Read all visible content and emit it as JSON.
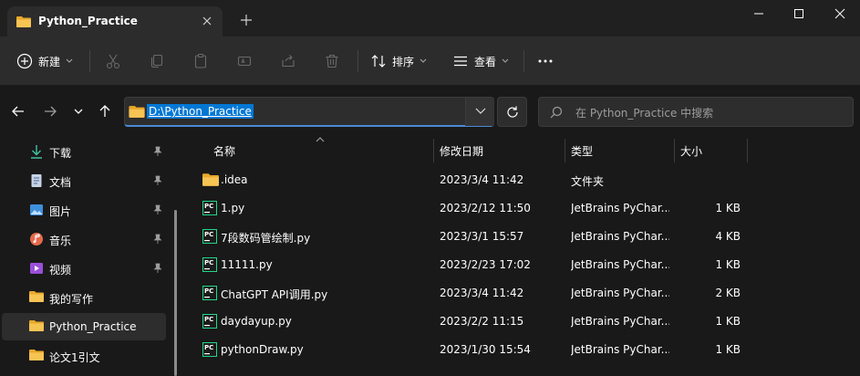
{
  "tab": {
    "title": "Python_Practice"
  },
  "toolbar": {
    "new_label": "新建",
    "sort_label": "排序",
    "view_label": "查看"
  },
  "address": {
    "path": "D:\\Python_Practice",
    "search_placeholder": "在 Python_Practice 中搜索"
  },
  "sidebar": {
    "items": [
      {
        "label": "下载",
        "icon": "download-icon",
        "pinned": true
      },
      {
        "label": "文档",
        "icon": "document-icon",
        "pinned": true
      },
      {
        "label": "图片",
        "icon": "pictures-icon",
        "pinned": true
      },
      {
        "label": "音乐",
        "icon": "music-icon",
        "pinned": true
      },
      {
        "label": "视频",
        "icon": "video-icon",
        "pinned": true
      },
      {
        "label": "我的写作",
        "icon": "folder-icon",
        "pinned": false
      },
      {
        "label": "Python_Practice",
        "icon": "folder-icon",
        "pinned": false,
        "active": true
      },
      {
        "label": "论文1引文",
        "icon": "folder-icon",
        "pinned": false
      }
    ]
  },
  "columns": {
    "name": "名称",
    "date": "修改日期",
    "type": "类型",
    "size": "大小"
  },
  "files": [
    {
      "name": ".idea",
      "date": "2023/3/4 11:42",
      "type": "文件夹",
      "size": "",
      "icon": "folder-icon"
    },
    {
      "name": "1.py",
      "date": "2023/2/12 11:50",
      "type": "JetBrains PyChar...",
      "size": "1 KB",
      "icon": "pycharm-file-icon"
    },
    {
      "name": "7段数码管绘制.py",
      "date": "2023/3/1 15:57",
      "type": "JetBrains PyChar...",
      "size": "4 KB",
      "icon": "pycharm-file-icon"
    },
    {
      "name": "11111.py",
      "date": "2023/2/23 17:02",
      "type": "JetBrains PyChar...",
      "size": "1 KB",
      "icon": "pycharm-file-icon"
    },
    {
      "name": "ChatGPT API调用.py",
      "date": "2023/3/4 11:42",
      "type": "JetBrains PyChar...",
      "size": "2 KB",
      "icon": "pycharm-file-icon"
    },
    {
      "name": "daydayup.py",
      "date": "2023/2/2 11:15",
      "type": "JetBrains PyChar...",
      "size": "1 KB",
      "icon": "pycharm-file-icon"
    },
    {
      "name": "pythonDraw.py",
      "date": "2023/1/30 15:54",
      "type": "JetBrains PyChar...",
      "size": "1 KB",
      "icon": "pycharm-file-icon"
    }
  ],
  "colors": {
    "accent": "#0078d4",
    "folder": "#f2c14e",
    "bg": "#191919",
    "bar": "#2c2c2c"
  }
}
